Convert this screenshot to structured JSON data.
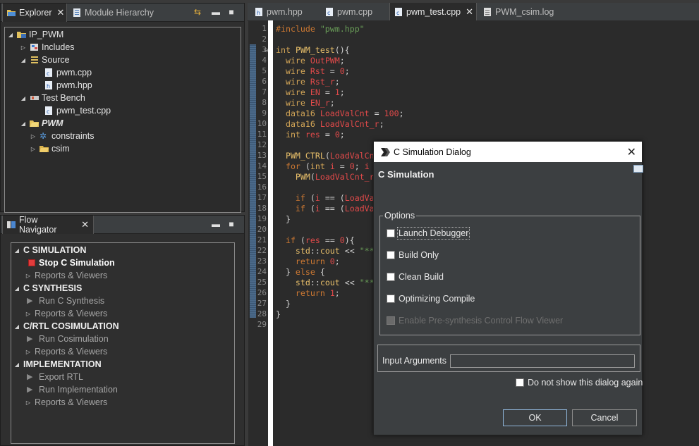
{
  "explorer": {
    "tabs": [
      {
        "label": "Explorer"
      },
      {
        "label": "Module Hierarchy"
      }
    ],
    "tree": [
      {
        "label": "IP_PWM"
      },
      {
        "label": "Includes"
      },
      {
        "label": "Source"
      },
      {
        "label": "pwm.cpp"
      },
      {
        "label": "pwm.hpp"
      },
      {
        "label": "Test Bench"
      },
      {
        "label": "pwm_test.cpp"
      },
      {
        "label": "PWM"
      },
      {
        "label": "constraints"
      },
      {
        "label": "csim"
      }
    ]
  },
  "flow_navigator": {
    "title": "Flow Navigator",
    "items": [
      {
        "label": "C SIMULATION"
      },
      {
        "label": "Stop C Simulation"
      },
      {
        "label": "Reports & Viewers"
      },
      {
        "label": "C SYNTHESIS"
      },
      {
        "label": "Run C Synthesis"
      },
      {
        "label": "Reports & Viewers"
      },
      {
        "label": "C/RTL COSIMULATION"
      },
      {
        "label": "Run Cosimulation"
      },
      {
        "label": "Reports & Viewers"
      },
      {
        "label": "IMPLEMENTATION"
      },
      {
        "label": "Export RTL"
      },
      {
        "label": "Run Implementation"
      },
      {
        "label": "Reports & Viewers"
      }
    ]
  },
  "editor": {
    "tabs": [
      {
        "label": "pwm.hpp"
      },
      {
        "label": "pwm.cpp"
      },
      {
        "label": "pwm_test.cpp"
      },
      {
        "label": "PWM_csim.log"
      }
    ],
    "line_numbers": [
      "1",
      "2",
      "3",
      "4",
      "5",
      "6",
      "7",
      "8",
      "9",
      "10",
      "11",
      "12",
      "13",
      "14",
      "15",
      "16",
      "17",
      "18",
      "19",
      "20",
      "21",
      "22",
      "23",
      "24",
      "25",
      "26",
      "27",
      "28",
      "29"
    ]
  },
  "dialog": {
    "title": "C Simulation Dialog",
    "heading": "C Simulation",
    "options_label": "Options",
    "options": [
      {
        "label": "Launch Debugger"
      },
      {
        "label": "Build Only"
      },
      {
        "label": "Clean Build"
      },
      {
        "label": "Optimizing Compile"
      },
      {
        "label": "Enable Pre-synthesis Control Flow Viewer"
      }
    ],
    "input_arguments_label": "Input Arguments",
    "input_arguments_value": "",
    "dont_show_label": "Do not show this dialog again",
    "ok_label": "OK",
    "cancel_label": "Cancel"
  }
}
